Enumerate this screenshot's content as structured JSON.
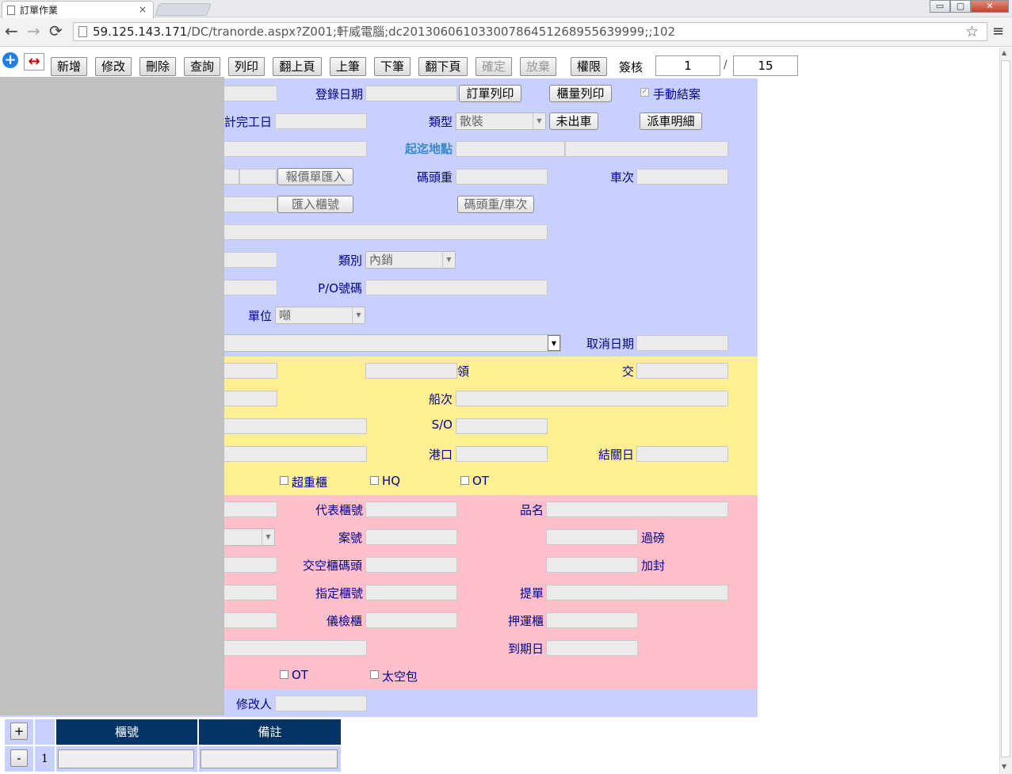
{
  "browser": {
    "tab_title": "訂單作業",
    "tab_close": "×",
    "url_host": "59.125.143.171",
    "url_path": "/DC/tranorde.aspx?Z001;軒威電腦;dc20130606103300786451268955639999;;102",
    "back": "←",
    "forward": "→",
    "reload": "⟳",
    "star": "☆",
    "menu": "≡",
    "min": "▭",
    "max": "▢",
    "close": "✕"
  },
  "toolbar": {
    "add_icon": "+",
    "swap_icon": "↔",
    "buttons": {
      "new": "新增",
      "edit": "修改",
      "delete": "刪除",
      "query": "查詢",
      "print": "列印",
      "prev_page": "翻上頁",
      "prev": "上筆",
      "next": "下筆",
      "next_page": "翻下頁",
      "confirm": "確定",
      "cancel": "放棄",
      "permission": "權限"
    },
    "approve_label": "簽核",
    "page_current": "1",
    "page_sep": "/",
    "page_total": "15"
  },
  "form": {
    "labels": {
      "reg_date": "登錄日期",
      "est_finish": "計完工日",
      "type": "類型",
      "from_to": "起迄地點",
      "wharf_weight": "碼頭重",
      "trip": "車次",
      "category": "類別",
      "po_no": "P/O號碼",
      "unit": "單位",
      "cancel_date": "取消日期",
      "receive": "領",
      "deliver": "交",
      "voyage": "船次",
      "so": "S/O",
      "port": "港口",
      "close_date": "結關日",
      "overweight": "超重櫃",
      "hq": "HQ",
      "ot1": "OT",
      "rep_container": "代表櫃號",
      "product": "品名",
      "case_no": "案號",
      "weigh": "過磅",
      "empty_return": "交空櫃碼頭",
      "seal": "加封",
      "assigned_container": "指定櫃號",
      "bl": "提單",
      "inspection": "儀檢櫃",
      "escort": "押運櫃",
      "expiry": "到期日",
      "ot2": "OT",
      "space_pack": "太空包",
      "modified_by": "修改人",
      "manual_close": "手動結案"
    },
    "buttons": {
      "order_print": "訂單列印",
      "container_print": "櫃量列印",
      "not_dispatched": "未出車",
      "dispatch_detail": "派車明細",
      "quote_import": "報價單匯入",
      "import_container": "匯入櫃號",
      "wharf_trip": "碼頭重/車次"
    },
    "selects": {
      "type_value": "散裝",
      "category_value": "內銷",
      "unit_value": "噸"
    },
    "colors": {
      "section_blue": "#c8d0ff",
      "section_yellow": "#ffef93",
      "section_pink": "#ffc0cb",
      "label": "#00008b"
    }
  },
  "grid": {
    "add": "+",
    "remove": "-",
    "col_container": "櫃號",
    "col_note": "備註",
    "row_no": "1"
  }
}
